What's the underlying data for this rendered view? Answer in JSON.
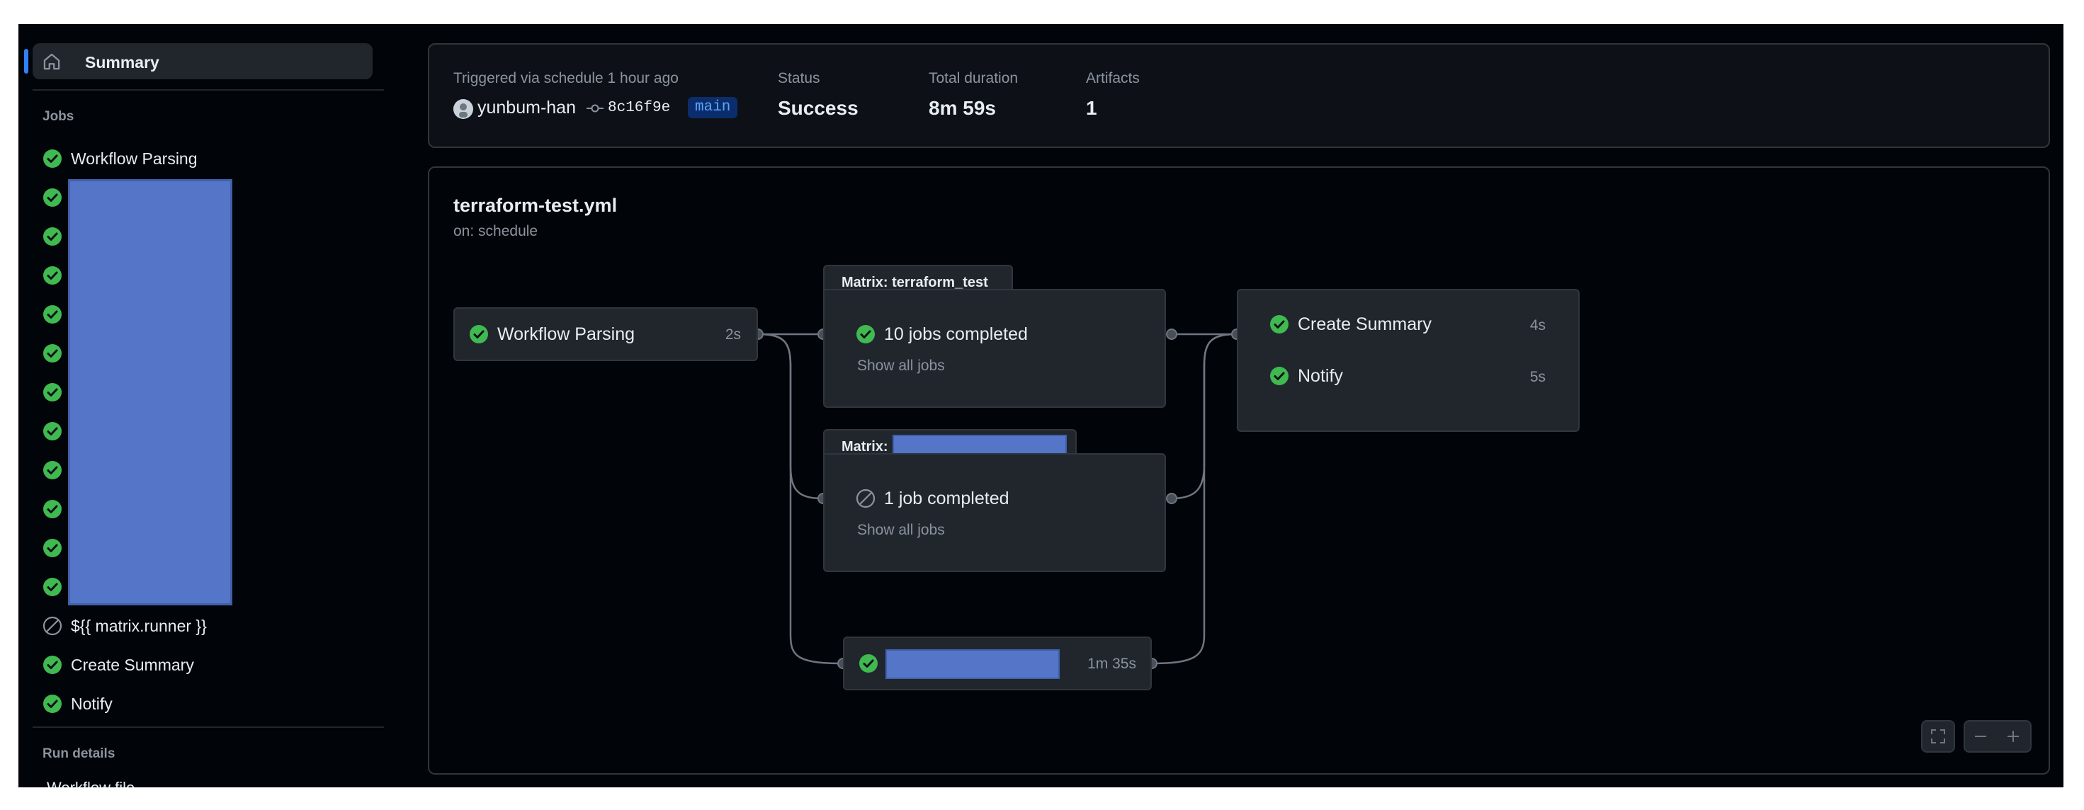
{
  "sidebar": {
    "summary_label": "Summary",
    "jobs_heading": "Jobs",
    "jobs": [
      {
        "label": "Workflow Parsing",
        "status": "success"
      },
      {
        "label": "",
        "status": "success"
      },
      {
        "label": "",
        "status": "success"
      },
      {
        "label": "",
        "status": "success"
      },
      {
        "label": "",
        "status": "success"
      },
      {
        "label": "",
        "status": "success"
      },
      {
        "label": "",
        "status": "success"
      },
      {
        "label": "",
        "status": "success"
      },
      {
        "label": "",
        "status": "success"
      },
      {
        "label": "",
        "status": "success"
      },
      {
        "label": "",
        "status": "success"
      },
      {
        "label": "",
        "status": "success"
      },
      {
        "label": "${{ matrix.runner }}",
        "status": "skipped"
      },
      {
        "label": "Create Summary",
        "status": "success"
      },
      {
        "label": "Notify",
        "status": "success"
      }
    ],
    "run_details_heading": "Run details",
    "run_details_items": [
      {
        "label": "Workflow file"
      }
    ]
  },
  "summary": {
    "trigger_text": "Triggered via schedule 1 hour ago",
    "actor": "yunbum-han",
    "commit": "8c16f9e",
    "branch": "main",
    "status_label": "Status",
    "status_value": "Success",
    "duration_label": "Total duration",
    "duration_value": "8m 59s",
    "artifacts_label": "Artifacts",
    "artifacts_value": "1"
  },
  "graph": {
    "workflow_file": "terraform-test.yml",
    "trigger": "on: schedule",
    "parse_job": {
      "label": "Workflow Parsing",
      "duration": "2s"
    },
    "matrix_1": {
      "title": "Matrix: terraform_test",
      "summary": "10 jobs completed",
      "link": "Show all jobs"
    },
    "matrix_2": {
      "title": "Matrix:",
      "summary": "1 job completed",
      "link": "Show all jobs"
    },
    "single_job": {
      "duration": "1m 35s"
    },
    "final_jobs": [
      {
        "label": "Create Summary",
        "duration": "4s"
      },
      {
        "label": "Notify",
        "duration": "5s"
      }
    ]
  },
  "colors": {
    "success": "#3fb950",
    "skipped": "#8b949e",
    "accent": "#2f81f7",
    "redacted": "#5475c8"
  },
  "icons": {
    "success": "check-circle-fill-icon",
    "skipped": "skip-circle-icon",
    "home": "home-icon",
    "commit": "git-commit-icon",
    "fullscreen": "screen-full-icon",
    "zoom_out": "dash-icon",
    "zoom_in": "plus-icon"
  }
}
